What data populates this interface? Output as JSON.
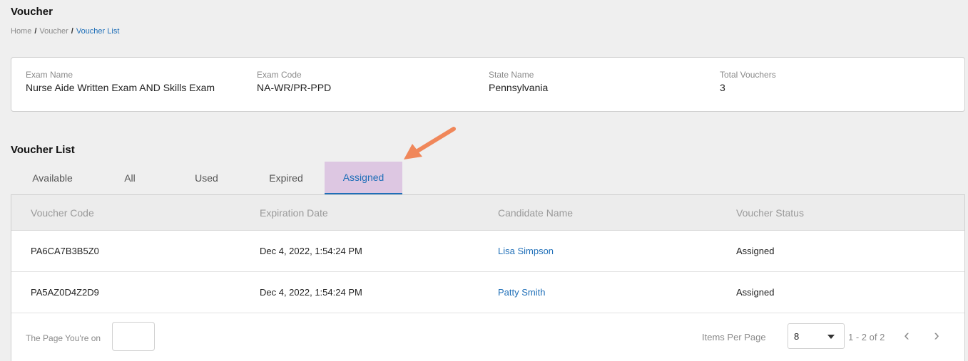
{
  "header": {
    "title": "Voucher",
    "breadcrumb": [
      "Home",
      "Voucher",
      "Voucher List"
    ],
    "separator": "/"
  },
  "exam_info": {
    "fields": [
      {
        "label": "Exam Name",
        "value": "Nurse Aide Written Exam AND Skills Exam"
      },
      {
        "label": "Exam Code",
        "value": "NA-WR/PR-PPD"
      },
      {
        "label": "State Name",
        "value": "Pennsylvania"
      },
      {
        "label": "Total Vouchers",
        "value": "3"
      }
    ]
  },
  "voucher_list": {
    "title": "Voucher List",
    "tabs": [
      "Available",
      "All",
      "Used",
      "Expired",
      "Assigned"
    ],
    "active_tab": "Assigned",
    "columns": [
      "Voucher Code",
      "Expiration Date",
      "Candidate Name",
      "Voucher Status"
    ],
    "rows": [
      {
        "code": "PA6CA7B3B5Z0",
        "expiration": "Dec 4, 2022, 1:54:24 PM",
        "candidate": "Lisa Simpson",
        "status": "Assigned"
      },
      {
        "code": "PA5AZ0D4Z2D9",
        "expiration": "Dec 4, 2022, 1:54:24 PM",
        "candidate": "Patty Smith",
        "status": "Assigned"
      }
    ]
  },
  "pagination": {
    "page_label": "The Page You're on",
    "page_value": "",
    "items_per_page_label": "Items Per Page",
    "items_per_page": "8",
    "range": "1 - 2 of 2",
    "prev_icon": "‹",
    "next_icon": "›"
  },
  "colors": {
    "accent": "#1f6fb8",
    "active_tab_bg": "#ddc7e2",
    "annotation_arrow": "#f0875a"
  }
}
